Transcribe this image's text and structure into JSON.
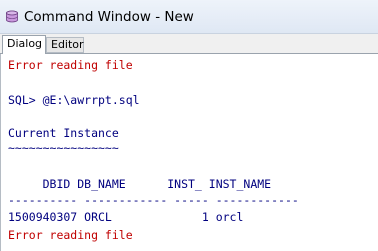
{
  "window": {
    "title": "Command Window - New"
  },
  "tabs": [
    {
      "label": "Dialog",
      "active": true
    },
    {
      "label": "Editor",
      "active": false
    }
  ],
  "console": {
    "lines": [
      {
        "text": "Error reading file",
        "color": "#c00000"
      },
      {
        "text": "SQL> @E:\\awrrpt.sql",
        "color": "#00007f"
      },
      {
        "text": "Current Instance",
        "color": "#00007f"
      },
      {
        "text": "~~~~~~~~~~~~~~~~",
        "color": "#00007f"
      },
      {
        "text": "     DBID DB_NAME      INST_ INST_NAME",
        "color": "#00007f"
      },
      {
        "text": "---------- ------------ ----- ------------",
        "color": "#00007f"
      },
      {
        "text": "1500940307 ORCL             1 orcl",
        "color": "#00007f"
      },
      {
        "text": "Error reading file",
        "color": "#c00000"
      }
    ]
  },
  "colors": {
    "error": "#c00000",
    "output": "#00007f"
  },
  "icons": {
    "app": "database-cylinder-icon"
  }
}
